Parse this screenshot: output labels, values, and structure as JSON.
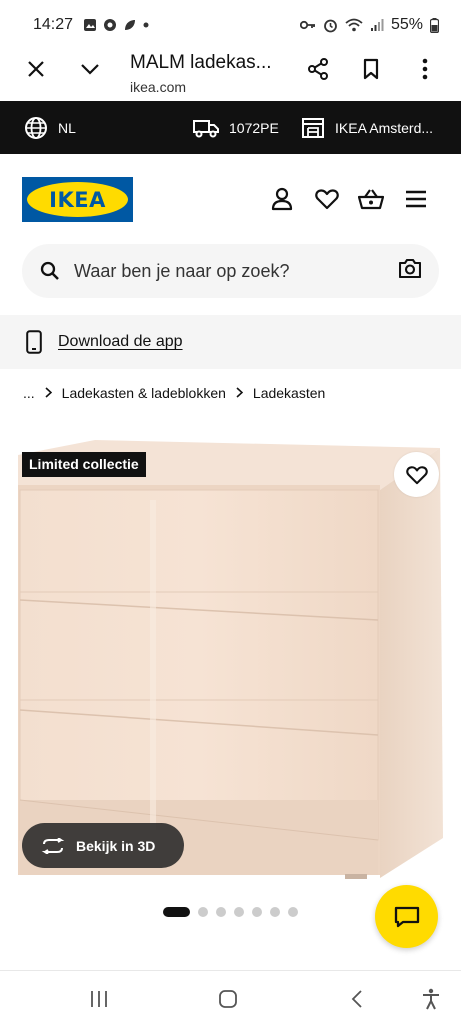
{
  "status_bar": {
    "time": "14:27",
    "battery": "55%"
  },
  "browser": {
    "page_title": "MALM ladekas...",
    "url": "ikea.com"
  },
  "top_strip": {
    "language": "NL",
    "postcode": "1072PE",
    "store": "IKEA Amsterd..."
  },
  "header": {
    "logo_text": "IKEA"
  },
  "search": {
    "placeholder": "Waar ben je naar op zoek?"
  },
  "app_banner": {
    "label": "Download de app"
  },
  "breadcrumb": {
    "ellipsis": "...",
    "items": [
      "Ladekasten & ladeblokken",
      "Ladekasten"
    ]
  },
  "product": {
    "badge": "Limited collectie",
    "view3d_label": "Bekijk in 3D",
    "image_count": 7,
    "active_image": 1
  },
  "colors": {
    "ikea_blue": "#0058a3",
    "ikea_yellow": "#ffdb00",
    "strip_bg": "#111111",
    "drawer_color": "#f2dccb"
  }
}
